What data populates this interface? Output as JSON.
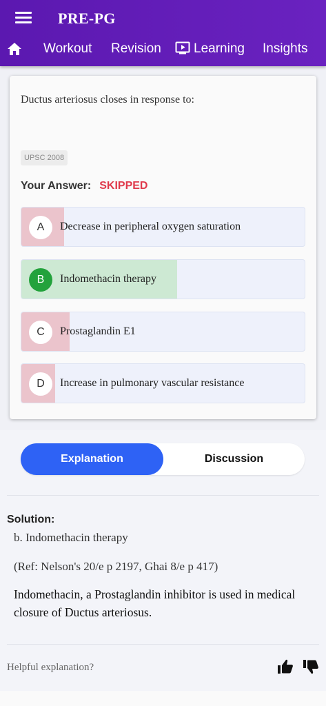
{
  "header": {
    "app_title": "PRE-PG",
    "menu_icon": "hamburger-menu-icon",
    "nav": {
      "home_icon": "home-icon",
      "items": [
        "Workout",
        "Revision",
        "Learning",
        "Insights"
      ],
      "learning_icon": "play-screen-icon"
    },
    "colors": {
      "bar": "#5b18b0",
      "text": "#ffffff"
    }
  },
  "question": {
    "text": "Ductus arteriosus closes in response to:",
    "tag": "UPSC 2008",
    "your_answer_label": "Your Answer:",
    "your_answer_value": "SKIPPED",
    "options": [
      {
        "letter": "A",
        "text": "Decrease in peripheral oxygen saturation",
        "status": "wrong"
      },
      {
        "letter": "B",
        "text": "Indomethacin therapy",
        "status": "correct"
      },
      {
        "letter": "C",
        "text": "Prostaglandin E1",
        "status": "wrong"
      },
      {
        "letter": "D",
        "text": "Increase in pulmonary vascular resistance",
        "status": "wrong"
      }
    ],
    "colors": {
      "correct_fill": "#cde9d3",
      "wrong_fill": "#ebc4cc",
      "correct_circle": "#23a23c",
      "skipped_text": "#e0394b"
    }
  },
  "tabs": {
    "explanation": "Explanation",
    "discussion": "Discussion",
    "active": "Explanation",
    "active_color": "#2e62f5"
  },
  "solution": {
    "label": "Solution:",
    "answer": "b. Indomethacin therapy",
    "reference": "(Ref: Nelson's 20/e p 2197, Ghai 8/e p 417)",
    "explanation": "Indomethacin, a Prostaglandin inhibitor is used in medical closure of Ductus arteriosus."
  },
  "feedback": {
    "prompt": "Helpful explanation?",
    "like_icon": "thumbs-up-icon",
    "dislike_icon": "thumbs-down-icon"
  }
}
